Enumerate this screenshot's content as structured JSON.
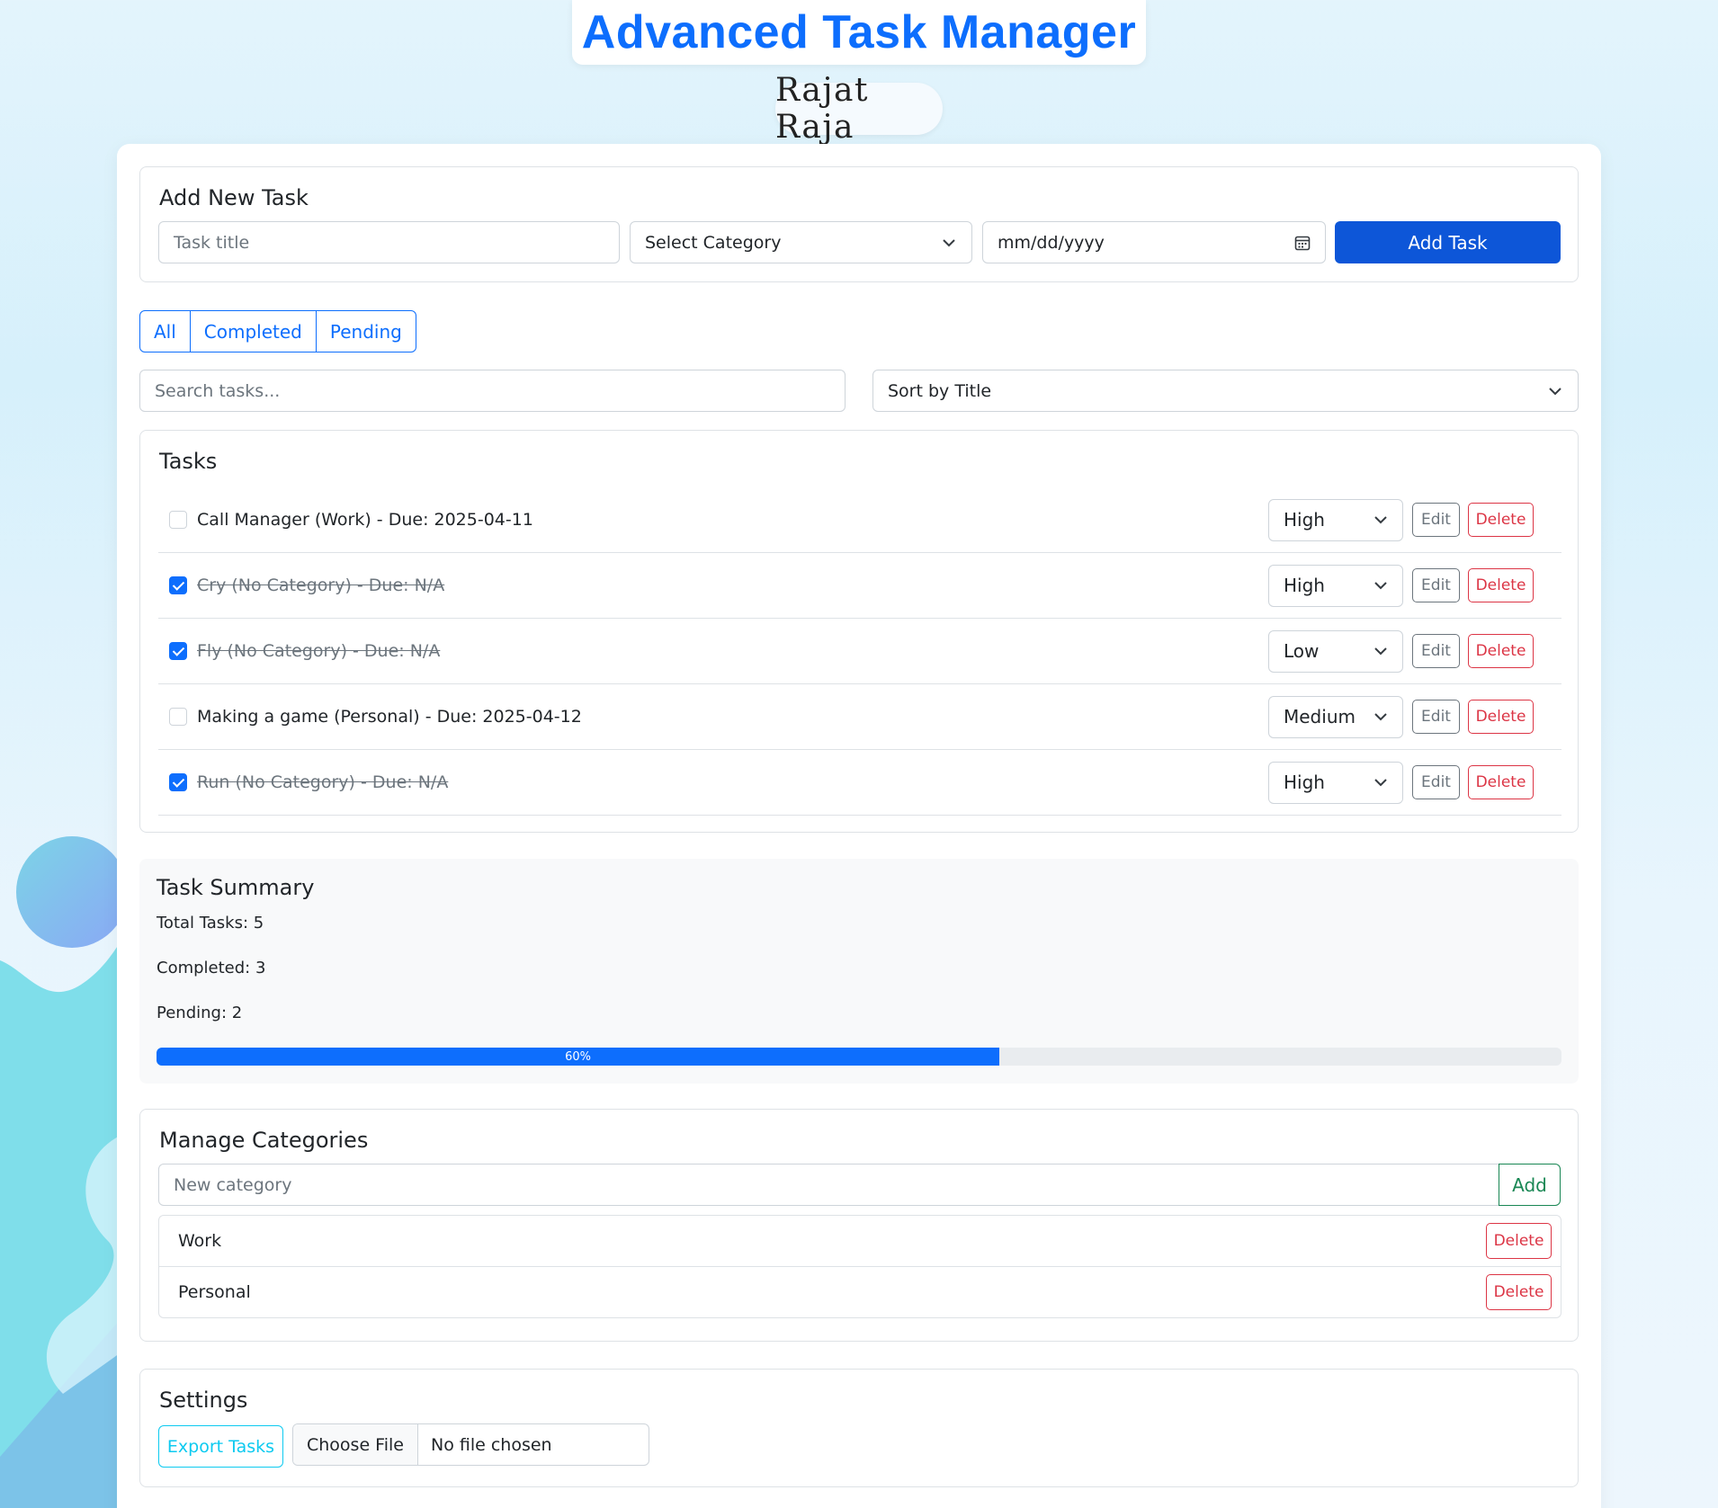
{
  "header": {
    "title": "Advanced Task Manager",
    "author": "Rajat Raja"
  },
  "add_task": {
    "heading": "Add New Task",
    "title_placeholder": "Task title",
    "category_selected": "Select Category",
    "date_placeholder": "mm/dd/yyyy",
    "submit_label": "Add Task"
  },
  "filters": {
    "buttons": [
      "All",
      "Completed",
      "Pending"
    ],
    "search_placeholder": "Search tasks...",
    "sort_selected": "Sort by Title"
  },
  "tasks": {
    "heading": "Tasks",
    "edit_label": "Edit",
    "delete_label": "Delete",
    "items": [
      {
        "text": "Call Manager (Work) - Due: 2025-04-11",
        "done": false,
        "priority": "High"
      },
      {
        "text": "Cry (No Category) - Due: N/A",
        "done": true,
        "priority": "High"
      },
      {
        "text": "Fly (No Category) - Due: N/A",
        "done": true,
        "priority": "Low"
      },
      {
        "text": "Making a game (Personal) - Due: 2025-04-12",
        "done": false,
        "priority": "Medium"
      },
      {
        "text": "Run (No Category) - Due: N/A",
        "done": true,
        "priority": "High"
      }
    ]
  },
  "summary": {
    "heading": "Task Summary",
    "total": "Total Tasks: 5",
    "completed": "Completed: 3",
    "pending": "Pending: 2",
    "progress_label": "60%",
    "progress_fraction": 0.6
  },
  "categories": {
    "heading": "Manage Categories",
    "input_placeholder": "New category",
    "add_label": "Add",
    "delete_label": "Delete",
    "items": [
      "Work",
      "Personal"
    ]
  },
  "settings": {
    "heading": "Settings",
    "export_label": "Export Tasks",
    "choose_file_label": "Choose File",
    "no_file_label": "No file chosen"
  },
  "colors": {
    "primary": "#0d6efd",
    "danger": "#dc3545",
    "success": "#198754",
    "info": "#0dcaf0"
  }
}
